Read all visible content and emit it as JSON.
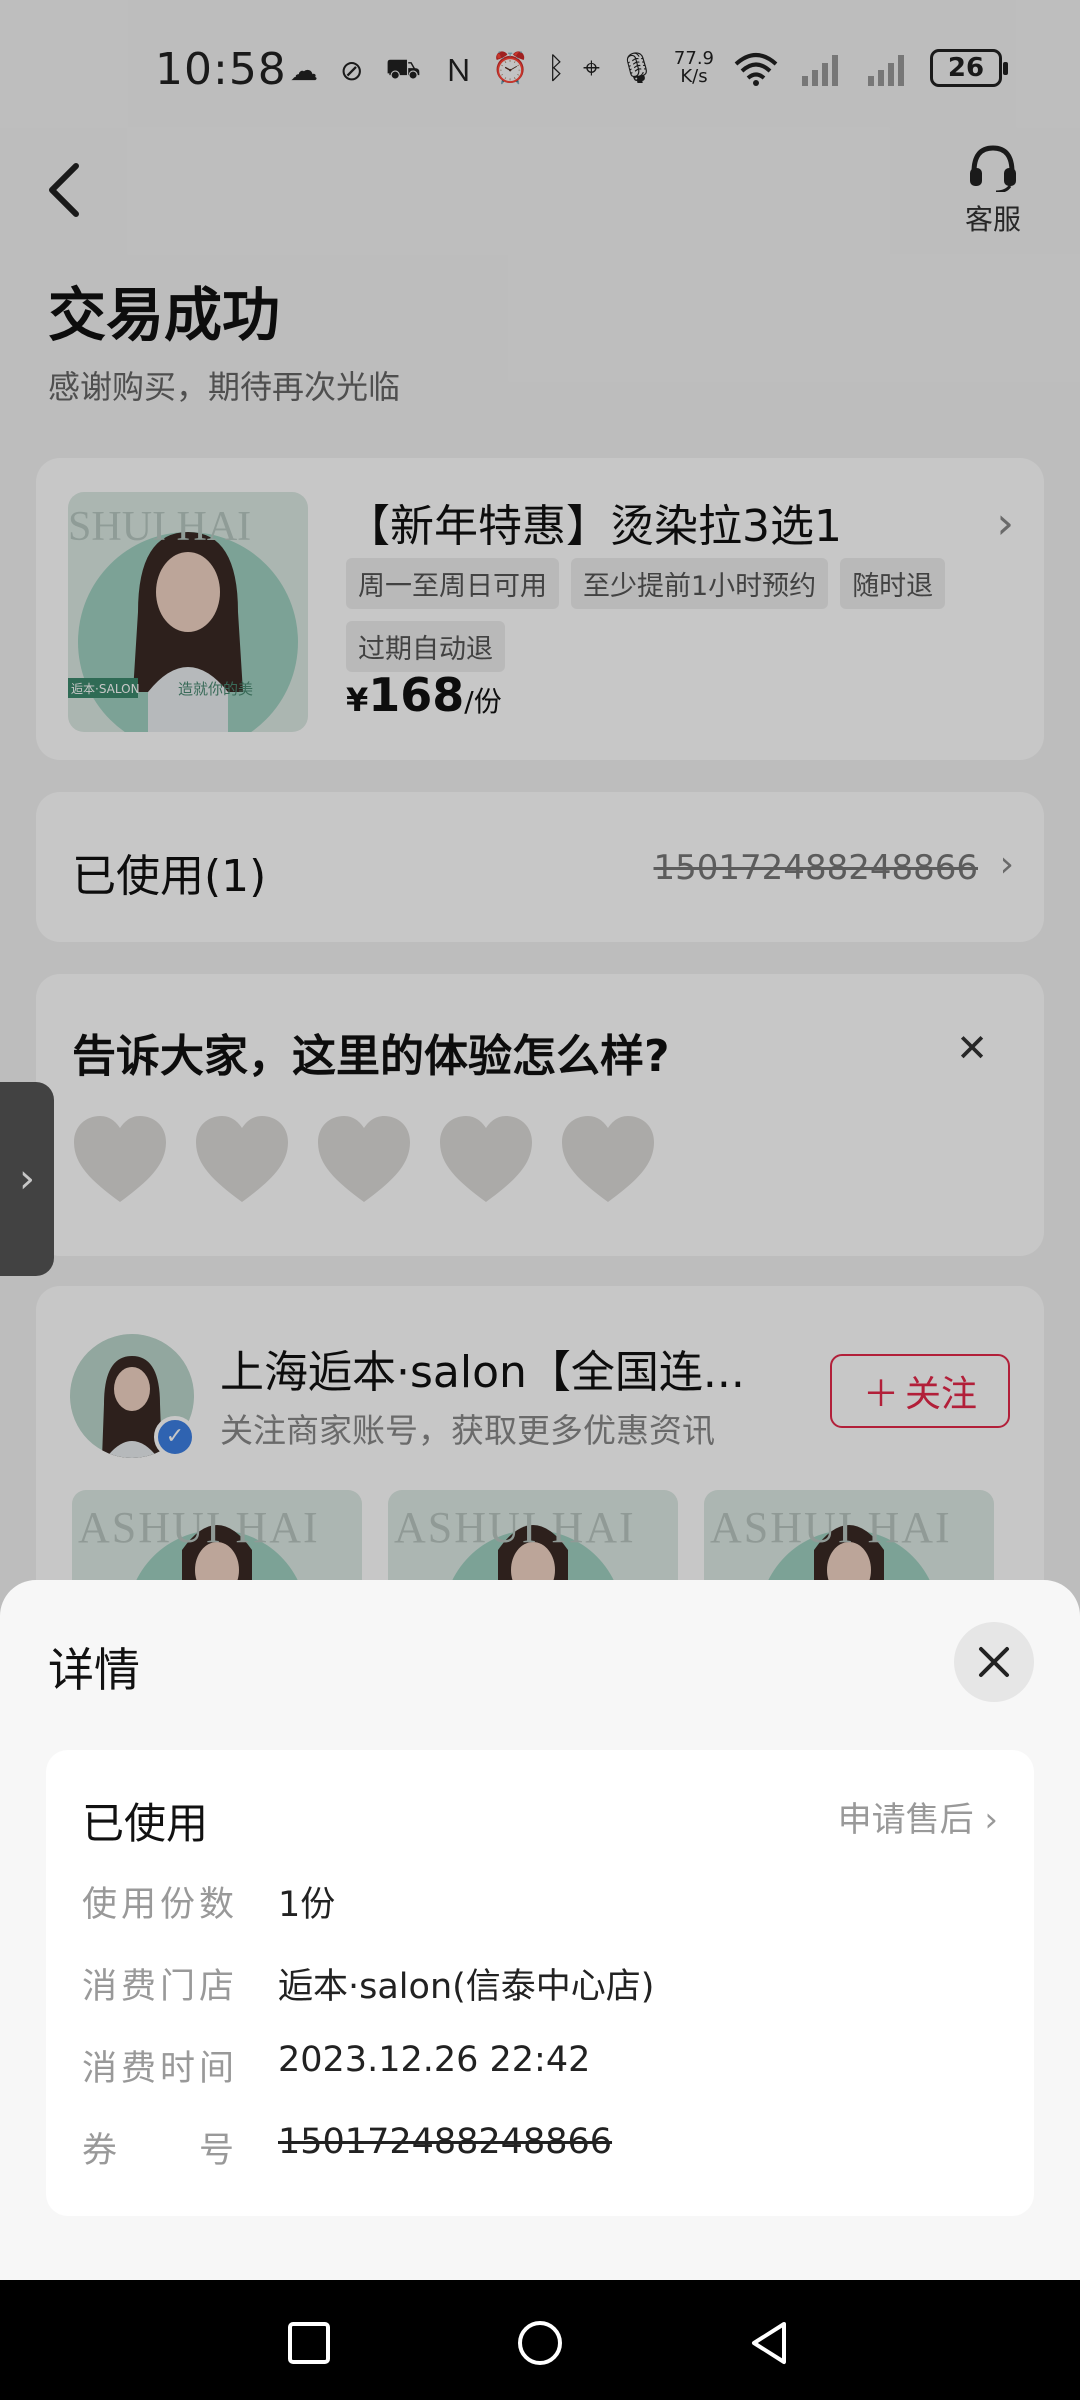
{
  "status_bar": {
    "time": "10:58",
    "speed_value": "77.9",
    "speed_unit": "K/s",
    "battery": "26"
  },
  "header": {
    "service_label": "客服",
    "title": "交易成功",
    "subtitle": "感谢购买，期待再次光临"
  },
  "product": {
    "title": "【新年特惠】烫染拉3选1",
    "tags": [
      "周一至周日可用",
      "至少提前1小时预约",
      "随时退",
      "过期自动退"
    ],
    "price_symbol": "¥",
    "price_value": "168",
    "price_unit": "/份",
    "image_text": "SHUI HAI",
    "image_badge": "逅本·SALON",
    "image_slogan": "造就你的美"
  },
  "used": {
    "label": "已使用(1)",
    "code": "150172488248866"
  },
  "review": {
    "question": "告诉大家，这里的体验怎么样?",
    "heart_count": 5
  },
  "merchant": {
    "name": "上海逅本·salon【全国连...",
    "desc": "关注商家账号，获取更多优惠资讯",
    "follow_label": "关注",
    "thumb_texts": [
      "ASHUI HAI",
      "ASHUI HAI",
      "ASHUI HAI"
    ]
  },
  "sheet": {
    "title": "详情",
    "status": "已使用",
    "after_sale": "申请售后",
    "rows": [
      {
        "key": "使用份数",
        "value": "1份"
      },
      {
        "key": "消费门店",
        "value": "逅本·salon(信泰中心店)"
      },
      {
        "key": "消费时间",
        "value": "2023.12.26 22:42"
      },
      {
        "key": "券　　号",
        "value": "150172488248866"
      }
    ]
  },
  "colors": {
    "accent_red": "#e5284a",
    "verified_blue": "#3d7fe3"
  }
}
